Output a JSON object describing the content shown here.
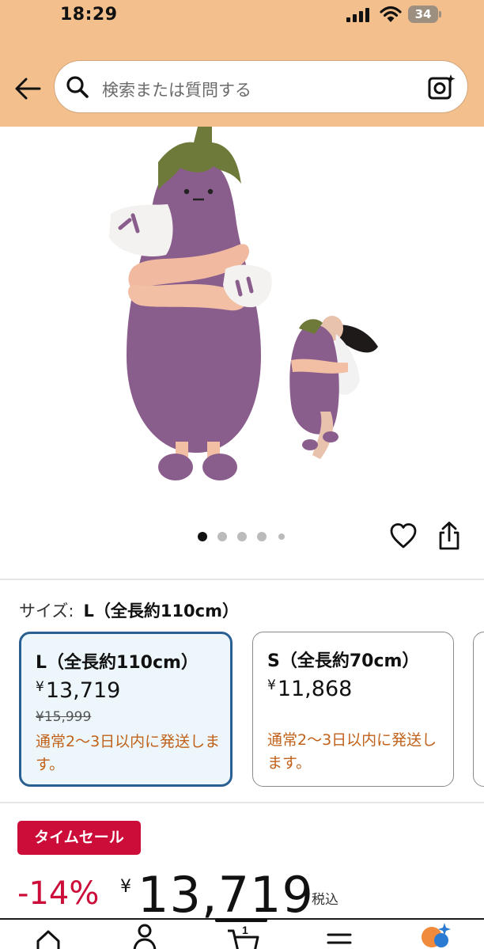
{
  "status_bar": {
    "time": "18:29",
    "battery": "34",
    "icons": [
      "cellular-signal-icon",
      "wifi-icon",
      "battery-icon"
    ]
  },
  "header": {
    "back_icon": "back-arrow-icon",
    "search_placeholder": "検索または質問する",
    "search_icon": "search-icon",
    "camera_icon": "camera-search-icon",
    "background_color": "#f3c08d"
  },
  "gallery": {
    "image_count": 5,
    "active_index": 0,
    "actions": [
      "heart-icon",
      "share-icon"
    ]
  },
  "size_selector": {
    "label": "サイズ:",
    "selected": "L（全長約110cm）",
    "options": [
      {
        "title": "L（全長約110cm）",
        "yen": "¥",
        "price": "13,719",
        "list_price": "¥15,999",
        "shipping": "通常2～3日以内に発送します。",
        "selected": true
      },
      {
        "title": "S（全長約70cm）",
        "yen": "¥",
        "price": "11,868",
        "list_price": "",
        "shipping": "通常2～3日以内に発送します。",
        "selected": false
      }
    ]
  },
  "deal": {
    "badge": "タイムセール",
    "discount": "-14%",
    "yen": "¥",
    "price": "13,719",
    "tax_label": "税込"
  },
  "tab_bar": {
    "cart_count": "1",
    "tabs": [
      "home-icon",
      "account-icon",
      "cart-icon",
      "menu-icon",
      "ai-assistant-icon"
    ]
  },
  "colors": {
    "accent_red": "#cc0c39",
    "selected_border": "#2a6091",
    "shipping_text": "#c1611a"
  }
}
